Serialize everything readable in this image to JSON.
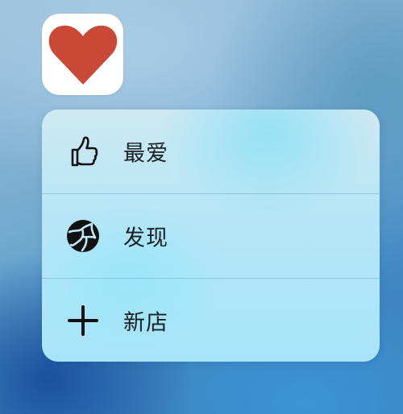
{
  "app": {
    "icon_name": "heart-icon",
    "icon_color": "#c94936"
  },
  "quick_actions": {
    "items": [
      {
        "label": "最爱",
        "icon": "thumbs-up-icon"
      },
      {
        "label": "发现",
        "icon": "globe-icon"
      },
      {
        "label": "新店",
        "icon": "plus-icon"
      }
    ]
  }
}
